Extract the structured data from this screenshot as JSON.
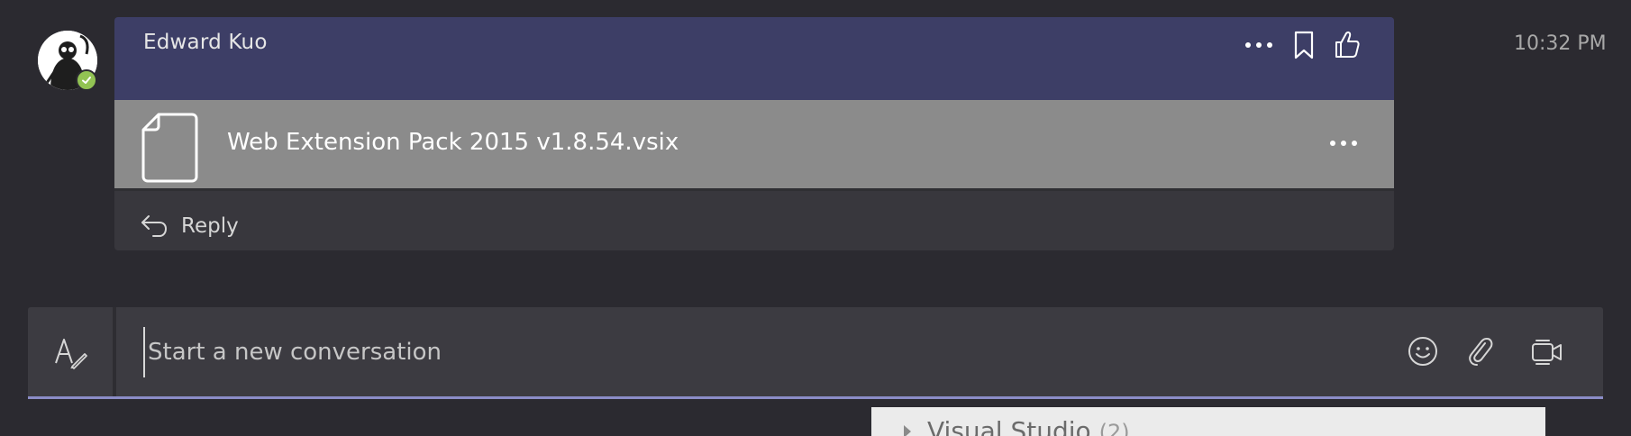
{
  "message": {
    "author": "Edward Kuo",
    "timestamp": "10:32 PM",
    "presence": "available",
    "header_actions": [
      "more-options",
      "bookmark",
      "like"
    ],
    "attachment": {
      "file_name": "Web Extension Pack 2015 v1.8.54.vsix",
      "icon": "file-icon"
    },
    "reply_label": "Reply"
  },
  "compose": {
    "placeholder": "Start a new conversation",
    "value": "",
    "actions": [
      "format",
      "emoji",
      "attach",
      "meet-now"
    ]
  },
  "background_panel": {
    "label": "Visual Studio",
    "count": "(2)"
  },
  "colors": {
    "app_background": "#2b2a30",
    "header_background": "#3d3e66",
    "attachment_background": "#8b8b8b",
    "card_background": "#38373d",
    "compose_background": "#3c3b41",
    "accent_underline": "#8b8cc7",
    "presence_available": "#92c353"
  }
}
